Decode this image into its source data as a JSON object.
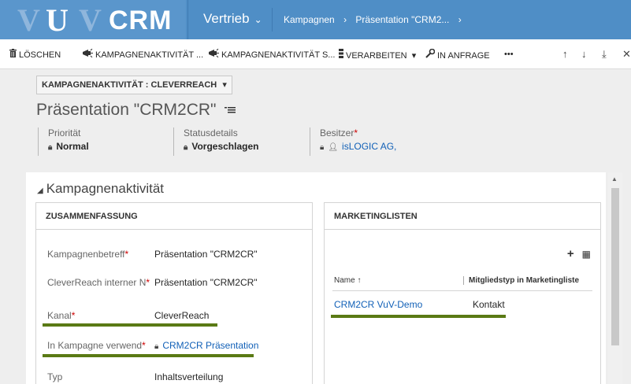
{
  "logo": {
    "v1": "V",
    "u": "U",
    "v2": "V",
    "crm": "CRM"
  },
  "nav": {
    "area": "Vertrieb",
    "area_chevron": "⌄",
    "breadcrumbs": [
      "Kampagnen",
      "›",
      "Präsentation \"CRM2...",
      "›"
    ]
  },
  "commands": {
    "delete": "Löschen",
    "campaign_activity_1": "Kampagnenaktivität ...",
    "campaign_activity_2": "Kampagnenaktivität S...",
    "process": "Verarbeiten",
    "process_chevron": "▾",
    "inquiry": "In Anfrage",
    "more": "•••",
    "up": "↑",
    "down": "↓",
    "expand": "⤓",
    "close": "✕"
  },
  "header": {
    "form_selector": "KAMPAGNENAKTIVITÄT : CLEVERREACH",
    "form_selector_chevron": "▾",
    "record_title": "Präsentation \"CRM2CR\"",
    "priority_label": "Priorität",
    "priority_value": "Normal",
    "status_label": "Statusdetails",
    "status_value": "Vorgeschlagen",
    "owner_label": "Besitzer",
    "owner_value": "isLOGIC AG,"
  },
  "section": {
    "title": "Kampagnenaktivität",
    "summary": {
      "heading": "ZUSAMMENFASSUNG",
      "fields": [
        {
          "label": "Kampagnenbetreff",
          "value": "Präsentation \"CRM2CR\"",
          "required": true
        },
        {
          "label": "CleverReach interner N",
          "value": "Präsentation \"CRM2CR\"",
          "required": true
        },
        {
          "label": "Kanal",
          "value": "CleverReach",
          "required": true
        },
        {
          "label": "In Kampagne verwend",
          "value": "CRM2CR Präsentation",
          "required": true
        },
        {
          "label": "Typ",
          "value": "Inhaltsverteilung",
          "required": false
        }
      ]
    },
    "marketing_lists": {
      "heading": "MARKETINGLISTEN",
      "add": "+",
      "grid_icon": "▦",
      "col_name": "Name ↑",
      "col_member_type": "Mitgliedstyp in Marketingliste",
      "rows": [
        {
          "name": "CRM2CR VuV-Demo",
          "member_type": "Kontakt"
        }
      ]
    }
  },
  "colors": {
    "nav_bg": "#4f8ec6",
    "link": "#1160b7",
    "highlight_bar": "#5a7a14",
    "required": "#cc0000"
  },
  "icons": {
    "delete": "trash-icon",
    "campaign_activity": "megaphone-icon",
    "process": "gear-icon",
    "inquiry": "wrench-icon",
    "lock": "lock-icon",
    "user": "user-icon",
    "record_menu": "list-icon"
  }
}
